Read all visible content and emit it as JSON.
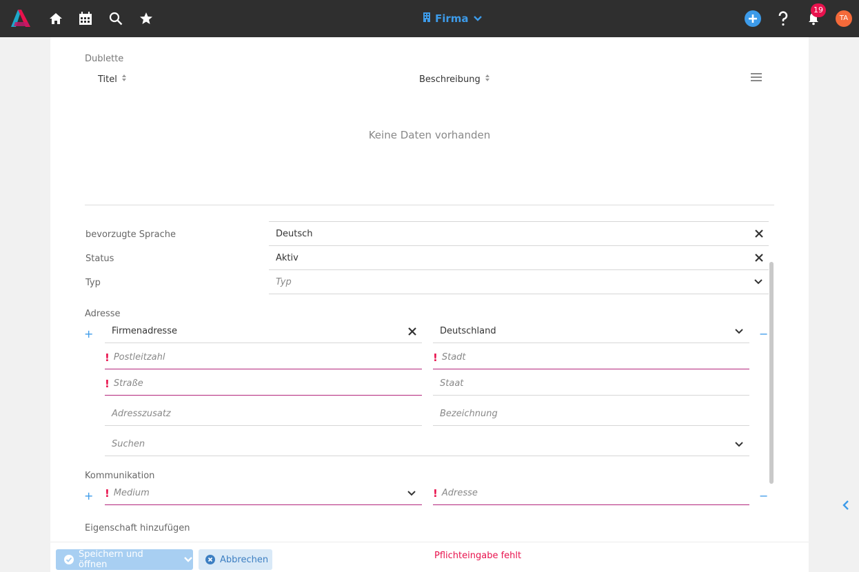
{
  "topbar": {
    "context_label": "Firma",
    "notification_count": "19",
    "avatar_initials": "TA",
    "icons": [
      "logo-icon",
      "home-icon",
      "calendar-icon",
      "search-icon",
      "star-icon",
      "building-icon",
      "chevron-down-icon",
      "plus-circle-icon",
      "help-icon",
      "bell-icon"
    ]
  },
  "dublette": {
    "section_label": "Dublette",
    "columns": [
      "Titel",
      "Beschreibung"
    ],
    "empty_text": "Keine Daten vorhanden"
  },
  "fields": {
    "sprache": {
      "label": "bevorzugte Sprache",
      "value": "Deutsch"
    },
    "status": {
      "label": "Status",
      "value": "Aktiv"
    },
    "typ": {
      "label": "Typ",
      "placeholder": "Typ"
    }
  },
  "adresse": {
    "section_label": "Adresse",
    "addresstype_value": "Firmenadresse",
    "country_value": "Deutschland",
    "postleitzahl_ph": "Postleitzahl",
    "stadt_ph": "Stadt",
    "strasse_ph": "Straße",
    "staat_ph": "Staat",
    "adresszusatz_ph": "Adresszusatz",
    "bezeichnung_ph": "Bezeichnung",
    "suchen_ph": "Suchen"
  },
  "kommunikation": {
    "section_label": "Kommunikation",
    "medium_ph": "Medium",
    "adresse_ph": "Adresse"
  },
  "eigenschaft": {
    "section_label": "Eigenschaft hinzufügen"
  },
  "footer": {
    "save_label": "Speichern und öffnen",
    "cancel_label": "Abbrechen",
    "error_text": "Pflichteingabe fehlt"
  },
  "colors": {
    "accent": "#3d9be9",
    "error": "#e8124d",
    "topbar": "#2f2f2f",
    "required_border": "#b3247a"
  }
}
